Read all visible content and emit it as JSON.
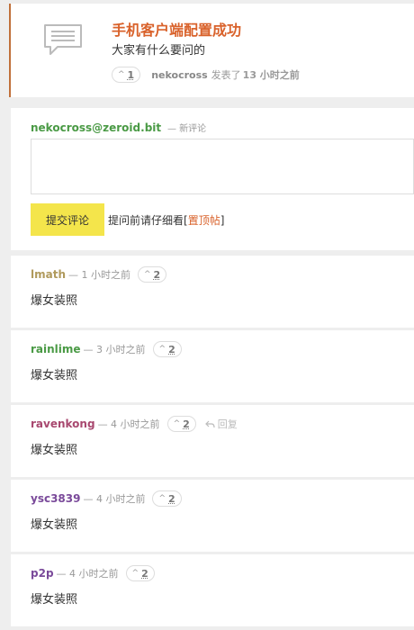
{
  "topic": {
    "title": "手机客户端配置成功",
    "body": "大家有什么要问的",
    "votes": "1",
    "author": "nekocross",
    "posted_text": "发表了",
    "time": "13 小时之前",
    "icon": "comment-bubble-icon"
  },
  "form": {
    "user": "nekocross@zeroid.bit",
    "user_suffix": "— 新评论",
    "textarea_value": "",
    "submit_label": "提交评论",
    "hint_prefix": "提问前请仔细看[",
    "hint_link": "置顶帖",
    "hint_suffix": "]"
  },
  "comments": [
    {
      "name": "lmath",
      "time": "— 1 小时之前",
      "votes": "2",
      "body": "爆女装照",
      "color": "#b09a5c"
    },
    {
      "name": "rainlime",
      "time": "— 3 小时之前",
      "votes": "2",
      "body": "爆女装照",
      "color": "#4a9a45"
    },
    {
      "name": "ravenkong",
      "time": "— 4 小时之前",
      "votes": "2",
      "reply": "回复",
      "body": "爆女装照",
      "color": "#a8486f"
    },
    {
      "name": "ysc3839",
      "time": "— 4 小时之前",
      "votes": "2",
      "body": "爆女装照",
      "color": "#7a4a9a"
    },
    {
      "name": "p2p",
      "time": "— 4 小时之前",
      "votes": "2",
      "body": "爆女装照",
      "color": "#7a4a9a"
    }
  ],
  "colors": {
    "accent": "#d9622b",
    "submit_bg": "#f4e54b",
    "username_green": "#4a9a45"
  }
}
